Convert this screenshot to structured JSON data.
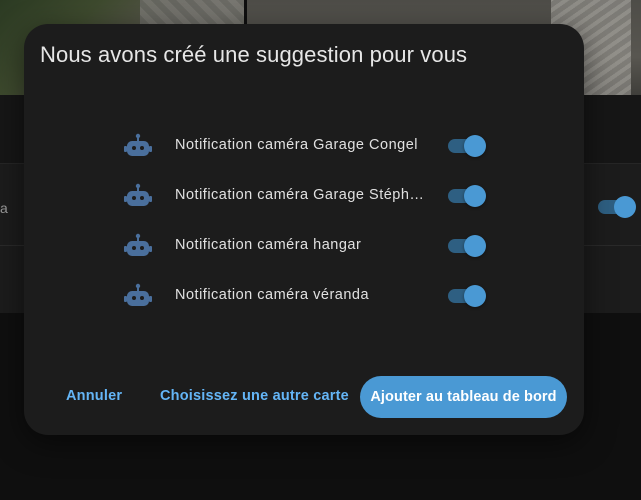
{
  "dialog": {
    "title": "Nous avons créé une suggestion pour vous",
    "rows": [
      {
        "label": "Notification caméra Garage Congel",
        "enabled": true,
        "icon": "robot-icon"
      },
      {
        "label": "Notification caméra Garage Stéphane",
        "enabled": true,
        "icon": "robot-icon"
      },
      {
        "label": "Notification caméra hangar",
        "enabled": true,
        "icon": "robot-icon"
      },
      {
        "label": "Notification caméra véranda",
        "enabled": true,
        "icon": "robot-icon"
      }
    ],
    "actions": {
      "cancel": "Annuler",
      "choose_other": "Choisissez une autre carte",
      "add": "Ajouter au tableau de bord"
    }
  },
  "background": {
    "stub_text": "a"
  },
  "colors": {
    "accent": "#4a99d4",
    "link": "#64b5f6",
    "icon": "#4a6f9c",
    "surface": "#1c1c1c"
  }
}
